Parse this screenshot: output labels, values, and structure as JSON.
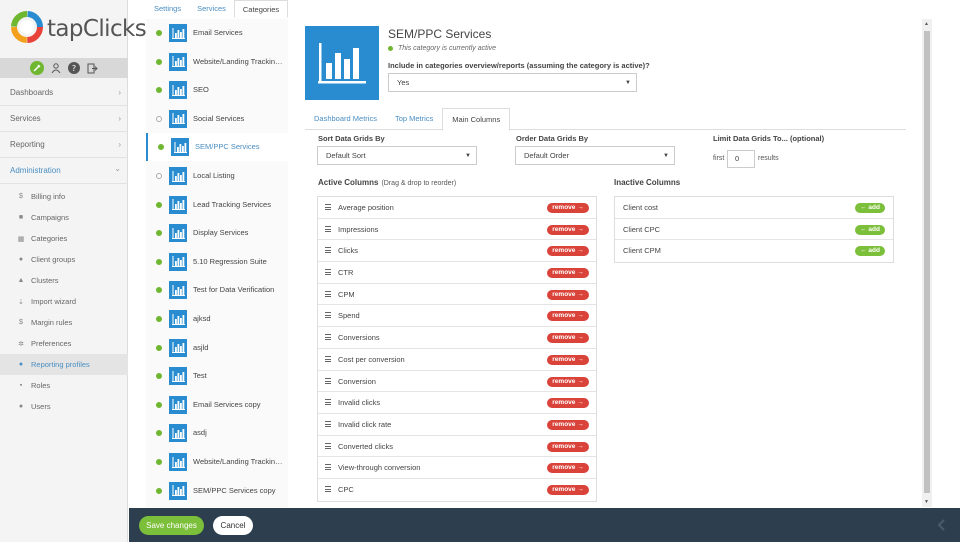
{
  "brand": {
    "name": "tapClicks",
    "accent": "#2a8cd0",
    "green": "#6fb730",
    "red": "#d9433a"
  },
  "sidebar": {
    "nav": [
      {
        "label": "Dashboards",
        "chevron": "›"
      },
      {
        "label": "Services",
        "chevron": "›"
      },
      {
        "label": "Reporting",
        "chevron": "›"
      },
      {
        "label": "Administration",
        "chevron": "⌄"
      }
    ],
    "admin_items": [
      {
        "label": "Billing info",
        "icon": "$"
      },
      {
        "label": "Campaigns",
        "icon": "■"
      },
      {
        "label": "Categories",
        "icon": "▦"
      },
      {
        "label": "Client groups",
        "icon": "●"
      },
      {
        "label": "Clusters",
        "icon": "▲"
      },
      {
        "label": "Import wizard",
        "icon": "⇣"
      },
      {
        "label": "Margin rules",
        "icon": "$"
      },
      {
        "label": "Preferences",
        "icon": "✲"
      },
      {
        "label": "Reporting profiles",
        "icon": "●"
      },
      {
        "label": "Roles",
        "icon": "▪"
      },
      {
        "label": "Users",
        "icon": "●"
      }
    ]
  },
  "top_tabs": [
    "Settings",
    "Services",
    "Categories"
  ],
  "categories": [
    {
      "label": "Email Services",
      "active": true
    },
    {
      "label": "Website/Landing Tracking...",
      "active": true
    },
    {
      "label": "SEO",
      "active": true
    },
    {
      "label": "Social Services",
      "active": false
    },
    {
      "label": "SEM/PPC Services",
      "active": true
    },
    {
      "label": "Local Listing",
      "active": false
    },
    {
      "label": "Lead Tracking Services",
      "active": true
    },
    {
      "label": "Display Services",
      "active": true
    },
    {
      "label": "5.10 Regression Suite",
      "active": true
    },
    {
      "label": "Test for Data Verification",
      "active": true
    },
    {
      "label": "ajksd",
      "active": true
    },
    {
      "label": "asjld",
      "active": true
    },
    {
      "label": "Test",
      "active": true
    },
    {
      "label": "Email Services copy",
      "active": true
    },
    {
      "label": "asdj",
      "active": true
    },
    {
      "label": "Website/Landing Tracking...",
      "active": true
    },
    {
      "label": "SEM/PPC Services copy",
      "active": true
    }
  ],
  "selected_category": {
    "title": "SEM/PPC Services",
    "status": "This category is currently active",
    "include_label": "Include in categories overview/reports (assuming the category is active)?",
    "include_value": "Yes"
  },
  "sub_tabs": [
    "Dashboard Metrics",
    "Top Metrics",
    "Main Columns"
  ],
  "sort": {
    "label": "Sort Data Grids By",
    "value": "Default Sort"
  },
  "order": {
    "label": "Order Data Grids By",
    "value": "Default Order"
  },
  "limit": {
    "label": "Limit Data Grids To... (optional)",
    "first": "first",
    "value": "0",
    "results": "results"
  },
  "active_columns": {
    "title": "Active Columns",
    "hint": "(Drag & drop to reorder)",
    "remove_label": "remove →",
    "items": [
      "Average position",
      "Impressions",
      "Clicks",
      "CTR",
      "CPM",
      "Spend",
      "Conversions",
      "Cost per conversion",
      "Conversion",
      "Invalid clicks",
      "Invalid click rate",
      "Converted clicks",
      "View-through conversion",
      "CPC"
    ]
  },
  "inactive_columns": {
    "title": "Inactive Columns",
    "add_label": "← add",
    "items": [
      "Client cost",
      "Client CPC",
      "Client CPM"
    ]
  },
  "footer": {
    "save": "Save changes",
    "cancel": "Cancel"
  }
}
